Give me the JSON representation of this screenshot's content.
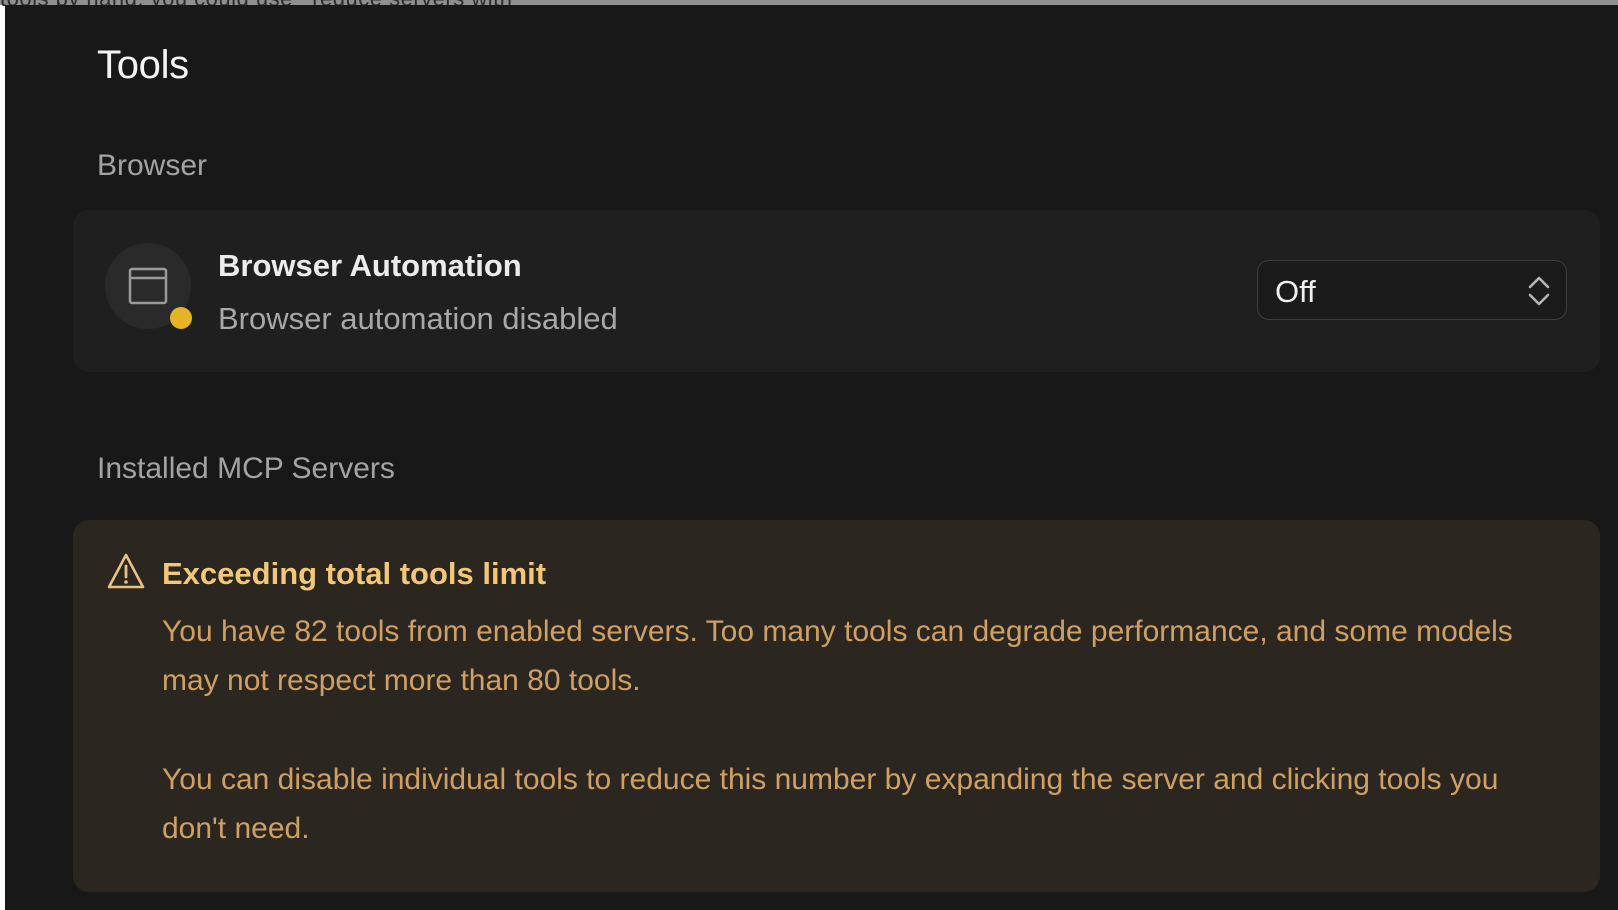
{
  "top_strip": {
    "partial_text": "tools by hand, you could use_ reduce servers with"
  },
  "page": {
    "title": "Tools"
  },
  "browser_section": {
    "label": "Browser",
    "item": {
      "title": "Browser Automation",
      "status": "Browser automation disabled",
      "icon": "browser-window-icon",
      "status_color": "#e6b422",
      "select": {
        "value": "Off"
      }
    }
  },
  "mcp_section": {
    "label": "Installed MCP Servers",
    "warning": {
      "icon": "warning-triangle-icon",
      "title": "Exceeding total tools limit",
      "paragraph1": "You have 82 tools from enabled servers. Too many tools can degrade performance, and some models may not respect more than 80 tools.",
      "paragraph2": "You can disable individual tools to reduce this number by expanding the server and clicking tools you don't need.",
      "title_color": "#f2c777",
      "text_color": "#cfa063"
    }
  }
}
